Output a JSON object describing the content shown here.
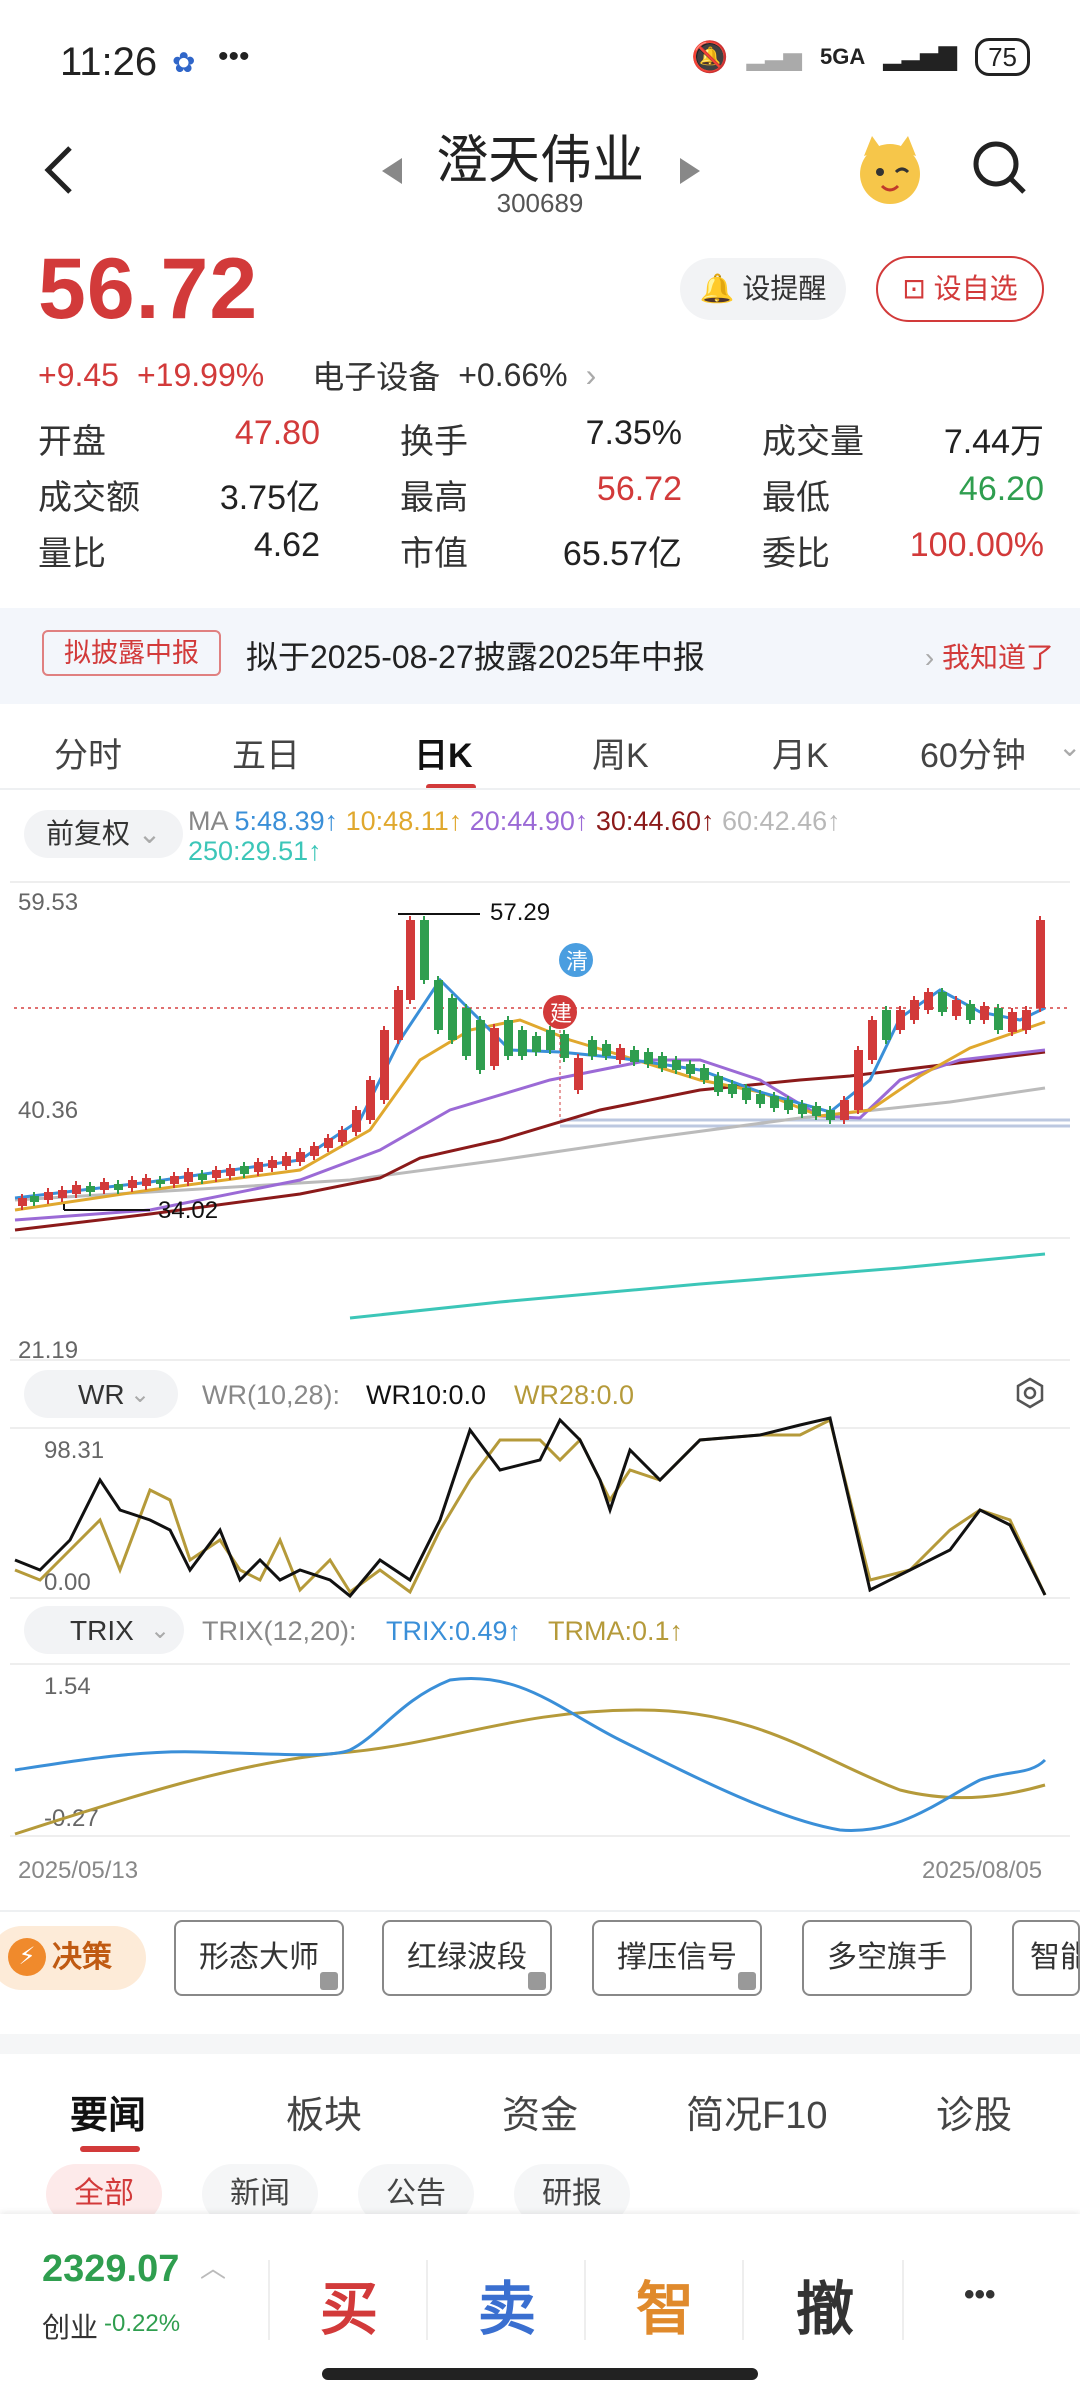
{
  "status": {
    "time": "11:26",
    "network": "5GA",
    "battery": "75"
  },
  "header": {
    "title": "澄天伟业",
    "code": "300689"
  },
  "quote": {
    "price": "56.72",
    "change": "+9.45",
    "change_pct": "+19.99%",
    "sector": "电子设备",
    "sector_change": "+0.66%",
    "remind_label": "设提醒",
    "fav_label": "设自选"
  },
  "stats": [
    [
      {
        "label": "开盘",
        "value": "47.80",
        "color": "red"
      },
      {
        "label": "换手",
        "value": "7.35%",
        "color": "dark"
      },
      {
        "label": "成交量",
        "value": "7.44万",
        "color": "dark"
      }
    ],
    [
      {
        "label": "成交额",
        "value": "3.75亿",
        "color": "dark"
      },
      {
        "label": "最高",
        "value": "56.72",
        "color": "red"
      },
      {
        "label": "最低",
        "value": "46.20",
        "color": "green"
      }
    ],
    [
      {
        "label": "量比",
        "value": "4.62",
        "color": "dark"
      },
      {
        "label": "市值",
        "value": "65.57亿",
        "color": "dark"
      },
      {
        "label": "委比",
        "value": "100.00%",
        "color": "red"
      }
    ]
  ],
  "announcement": {
    "tag": "拟披露中报",
    "text": "拟于2025-08-27披露2025年中报",
    "action": "我知道了"
  },
  "kline_tabs": [
    "分时",
    "五日",
    "日K",
    "周K",
    "月K",
    "60分钟"
  ],
  "kline_active": "日K",
  "ma_bar": {
    "adjust": "前复权",
    "ma_label": "MA",
    "items": [
      {
        "text": "5:48.39↑",
        "color": "#3a8fd8"
      },
      {
        "text": "10:48.11↑",
        "color": "#e0a82e"
      },
      {
        "text": "20:44.90↑",
        "color": "#9b6ad6"
      },
      {
        "text": "30:44.60↑",
        "color": "#8b1a1a"
      },
      {
        "text": "60:42.46↑",
        "color": "#b8b8b8"
      },
      {
        "text": "250:29.51↑",
        "color": "#3cc6b8"
      }
    ]
  },
  "main_chart_labels": {
    "y_top": "59.53",
    "y_mid": "40.36",
    "y_bottom": "21.19",
    "high_label": "57.29",
    "low_label": "34.02",
    "marker_qing": "清",
    "marker_jian": "建"
  },
  "wr": {
    "name": "WR",
    "params": "WR(10,28):",
    "wr10": "WR10:0.0",
    "wr28": "WR28:0.0",
    "y_top": "98.31",
    "y_bottom": "0.00"
  },
  "trix": {
    "name": "TRIX",
    "params": "TRIX(12,20):",
    "trix": "TRIX:0.49↑",
    "trma": "TRMA:0.1↑",
    "y_top": "1.54",
    "y_bottom": "-0.27"
  },
  "date_range": {
    "start": "2025/05/13",
    "end": "2025/08/05"
  },
  "chart_data": {
    "type": "candlestick",
    "y_range": [
      21.19,
      59.53
    ],
    "annotations": {
      "high": 57.29,
      "low": 34.02
    },
    "wr_range": [
      0.0,
      98.31
    ],
    "trix_range": [
      -0.27,
      1.54
    ],
    "x_start": "2025/05/13",
    "x_end": "2025/08/05"
  },
  "tools": {
    "juece": "决策",
    "items": [
      "形态大师",
      "红绿波段",
      "撑压信号",
      "多空旗手",
      "智能"
    ]
  },
  "news_tabs": [
    "要闻",
    "板块",
    "资金",
    "简况F10",
    "诊股"
  ],
  "news_sub_tabs": [
    "全部",
    "新闻",
    "公告",
    "研报"
  ],
  "bottom_bar": {
    "index_value": "2329.07",
    "index_name": "创业",
    "index_change": "-0.22%",
    "buy": "买",
    "sell": "卖",
    "smart": "智",
    "cancel": "撤",
    "more": "•••"
  }
}
